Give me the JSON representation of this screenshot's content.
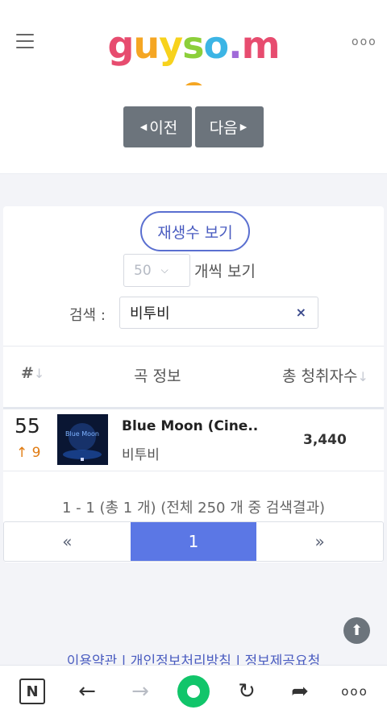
{
  "header": {
    "logo_letters": [
      "g",
      "u",
      "y",
      "s",
      "o",
      ".",
      "m",
      "e"
    ],
    "logo_colors": [
      "#e74c6f",
      "#f5a623",
      "#f7d21d",
      "#8ccf3a",
      "#3cb5e5",
      "#a06ad8",
      "#e74c6f",
      "#f5a623"
    ],
    "more_label": "ooo"
  },
  "nav": {
    "prev_label": "이전",
    "next_label": "다음"
  },
  "controls": {
    "play_count_label": "재생수 보기",
    "per_page_value": "50",
    "per_page_label": "개씩 보기",
    "search_label": "검색 :",
    "search_value": "비투비",
    "search_clear": "×"
  },
  "table": {
    "headers": {
      "rank": "#",
      "song_info": "곡 정보",
      "total_listeners": "총 청취자수"
    },
    "rows": [
      {
        "rank": "55",
        "change": "↑ 9",
        "title": "Blue Moon (Cine...",
        "artist": "비투비",
        "count": "3,440",
        "album_text": "Blue Moon"
      }
    ]
  },
  "summary": "1 - 1 (총 1 개) (전체 250 개 중 검색결과)",
  "pager": {
    "prev": "«",
    "current": "1",
    "next": "»"
  },
  "footer": {
    "links_text": "이용약관 | 개인정보처리방침 | 정보제공요청"
  },
  "bottom_bar": {
    "n_label": "N",
    "back": "←",
    "forward": "→",
    "refresh": "↻",
    "share": "➦",
    "more": "ooo"
  }
}
